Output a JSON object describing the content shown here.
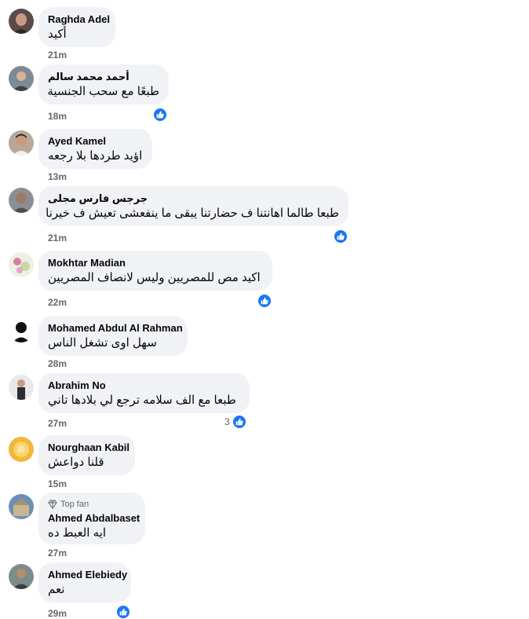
{
  "comments": [
    {
      "name": "Raghda Adel",
      "text": "أكيد",
      "time": "21m",
      "reaction_count": ""
    },
    {
      "name": "أحمد محمد سالم",
      "text": "طبعًا مع سحب الجنسية",
      "time": "18m",
      "reaction_count": ""
    },
    {
      "name": "Ayed Kamel",
      "text": "اؤيد طردها بلا رجعه",
      "time": "13m",
      "reaction_count": ""
    },
    {
      "name": "جرجس فارس مجلى",
      "text": "طبعا طالما اهانتنا ف حضارتنا يبقى ما ينفعشى تعيش ف خيرنا",
      "time": "21m",
      "reaction_count": ""
    },
    {
      "name": "Mokhtar Madian",
      "text": "اكيد مص للمصريين وليس لانصاف المصريين",
      "time": "22m",
      "reaction_count": ""
    },
    {
      "name": "Mohamed Abdul Al Rahman",
      "text": "سهل اوى تشغل الناس",
      "time": "28m",
      "reaction_count": ""
    },
    {
      "name": "Abrahim No",
      "text": "طبعا مع الف سلامه ترجع لي بلادها تاني",
      "time": "27m",
      "reaction_count": "3"
    },
    {
      "name": "Nourghaan Kabil",
      "text": "قلنا دواعش",
      "time": "15m",
      "reaction_count": ""
    },
    {
      "name": "Ahmed Abdalbaset",
      "badge": "Top fan",
      "text": "ايه العبط ده",
      "time": "27m",
      "reaction_count": ""
    },
    {
      "name": "Ahmed Elebiedy",
      "text": "نعم",
      "time": "29m",
      "reaction_count": ""
    }
  ],
  "icons": {
    "avatar": "avatar-icon",
    "badge": "diamond-icon",
    "reaction": "like-icon"
  },
  "colors": {
    "bubble": "#f0f2f5",
    "name": "#050505",
    "meta": "#65676b",
    "like": "#1877f2"
  }
}
